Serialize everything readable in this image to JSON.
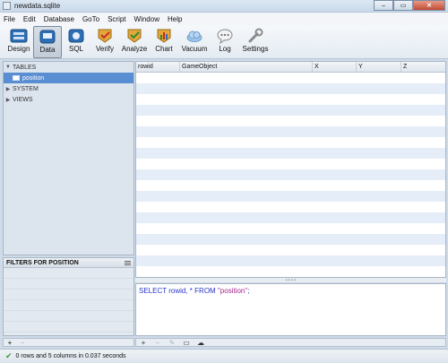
{
  "window": {
    "title": "newdata.sqlite"
  },
  "menu": [
    "File",
    "Edit",
    "Database",
    "GoTo",
    "Script",
    "Window",
    "Help"
  ],
  "toolbar": {
    "design": "Design",
    "data": "Data",
    "sql": "SQL",
    "verify": "Verify",
    "analyze": "Analyze",
    "chart": "Chart",
    "vacuum": "Vacuum",
    "log": "Log",
    "settings": "Settings"
  },
  "sidebar": {
    "tables_label": "TABLES",
    "selected_table": "position",
    "system_label": "SYSTEM",
    "views_label": "VIEWS"
  },
  "filters": {
    "title": "FILTERS FOR POSITION"
  },
  "grid": {
    "columns": [
      "rowid",
      "GameObject",
      "X",
      "Y",
      "Z"
    ]
  },
  "sql": {
    "select": "SELECT",
    "rowid": "rowid,",
    "star": "*",
    "from": "FROM",
    "table": "\"position\"",
    "end": ";"
  },
  "status": {
    "text": "0 rows and 5 columns in 0.037 seconds"
  },
  "colors": {
    "accent": "#5a8ed3",
    "sql_keyword": "#2a35c8",
    "sql_string": "#a3248b"
  }
}
